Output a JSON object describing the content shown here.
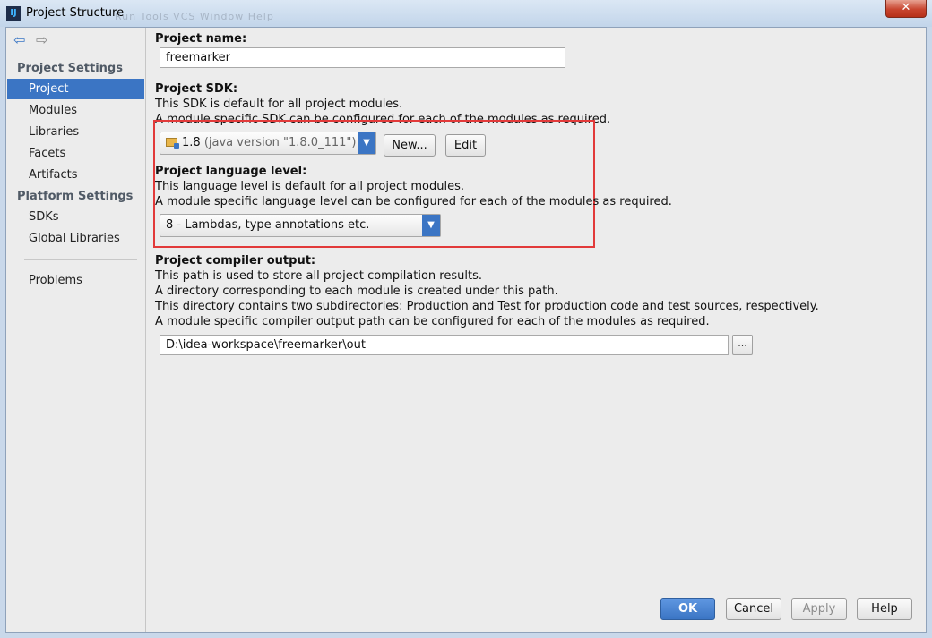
{
  "window": {
    "title": "Project Structure",
    "close_glyph": "✕",
    "ghost_menu": "Run  Tools  VCS  Window  Help"
  },
  "navigation": {
    "back_glyph": "⇦",
    "forward_glyph": "⇨"
  },
  "sidebar": {
    "project_settings_header": "Project Settings",
    "project_settings_items": [
      "Project",
      "Modules",
      "Libraries",
      "Facets",
      "Artifacts"
    ],
    "platform_settings_header": "Platform Settings",
    "platform_settings_items": [
      "SDKs",
      "Global Libraries"
    ],
    "problems": "Problems",
    "selected": "Project"
  },
  "project_name": {
    "label": "Project name:",
    "value": "freemarker"
  },
  "project_sdk": {
    "label": "Project SDK:",
    "desc1": "This SDK is default for all project modules.",
    "desc2": "A module specific SDK can be configured for each of the modules as required.",
    "selected_version": "1.8",
    "selected_detail": "(java version \"1.8.0_111\")",
    "new_button": "New...",
    "edit_button": "Edit"
  },
  "language_level": {
    "label": "Project language level:",
    "desc1": "This language level is default for all project modules.",
    "desc2": "A module specific language level can be configured for each of the modules as required.",
    "selected": "8 - Lambdas, type annotations etc."
  },
  "compiler_output": {
    "label": "Project compiler output:",
    "desc1": "This path is used to store all project compilation results.",
    "desc2": "A directory corresponding to each module is created under this path.",
    "desc3": "This directory contains two subdirectories: Production and Test for production code and test sources, respectively.",
    "desc4": "A module specific compiler output path can be configured for each of the modules as required.",
    "path": "D:\\idea-workspace\\freemarker\\out",
    "browse_label": "..."
  },
  "footer": {
    "ok": "OK",
    "cancel": "Cancel",
    "apply": "Apply",
    "help": "Help"
  },
  "icons": {
    "app": "intellij-logo-icon",
    "back": "arrow-left-icon",
    "forward": "arrow-right-icon",
    "sdk": "folder-icon",
    "dropdown": "chevron-down-icon"
  },
  "colors": {
    "accent": "#3b75c4",
    "highlight_border": "#e23a3a",
    "panel_bg": "#ececec"
  }
}
